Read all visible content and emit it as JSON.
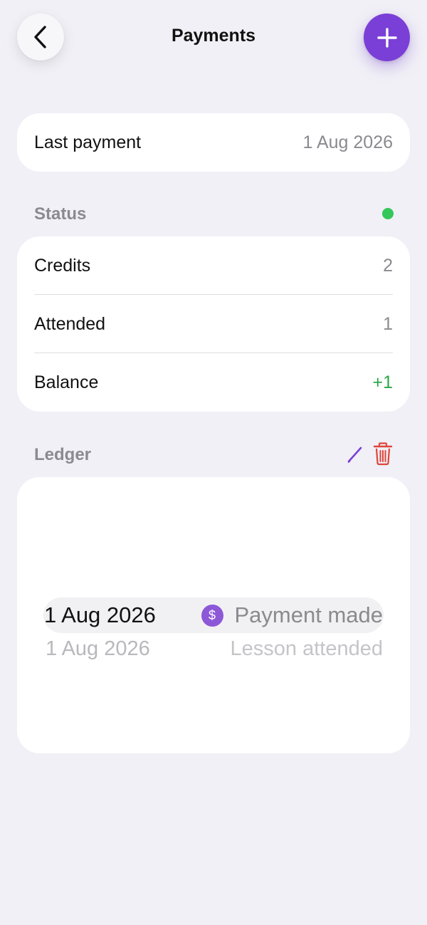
{
  "header": {
    "title": "Payments",
    "back_icon": "chevron-left-icon",
    "add_icon": "plus-icon"
  },
  "last_payment": {
    "label": "Last payment",
    "value": "1 Aug 2026"
  },
  "status": {
    "section_label": "Status",
    "indicator_color": "#34c759",
    "rows": [
      {
        "label": "Credits",
        "value": "2"
      },
      {
        "label": "Attended",
        "value": "1"
      },
      {
        "label": "Balance",
        "value": "+1"
      }
    ]
  },
  "ledger": {
    "section_label": "Ledger",
    "edit_icon": "pencil-icon",
    "delete_icon": "trash-icon",
    "entries": [
      {
        "date": "1 Aug 2026",
        "description": "Payment made",
        "icon": "dollar-icon",
        "icon_glyph": "$"
      },
      {
        "date": "1 Aug 2026",
        "description": "Lesson attended"
      }
    ]
  },
  "colors": {
    "accent": "#7a3fd6",
    "positive": "#2ba84a",
    "danger": "#e0453a",
    "background": "#f1f0f6"
  }
}
